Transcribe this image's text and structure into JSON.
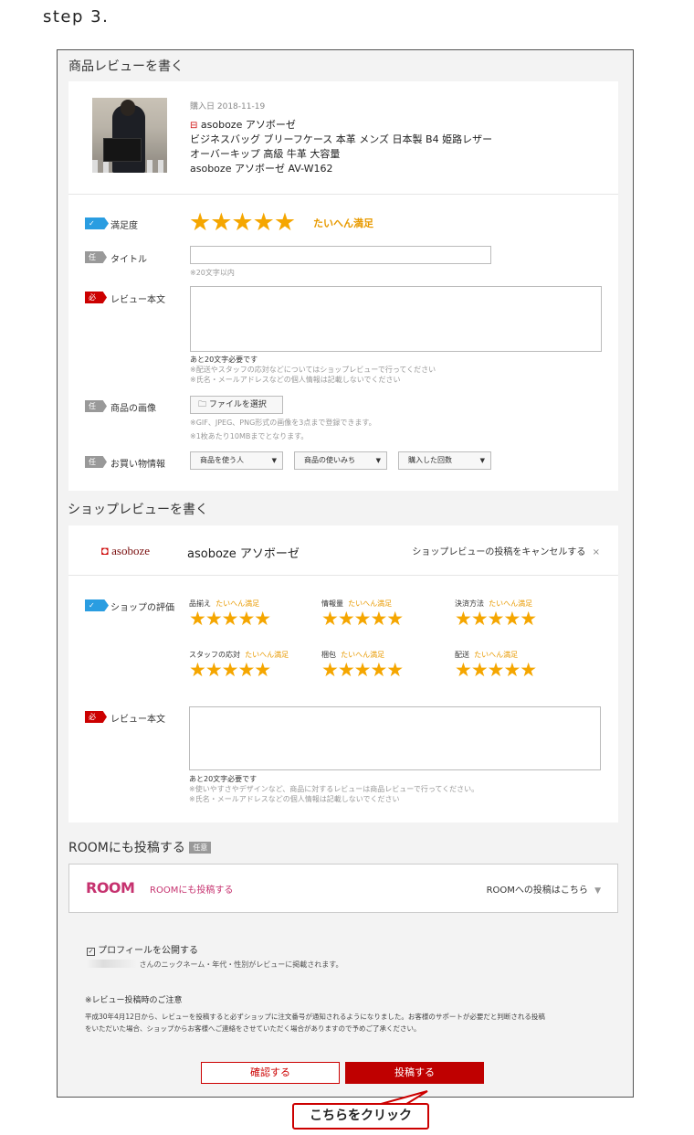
{
  "step_title": "step 3.",
  "product_review": {
    "heading": "商品レビューを書く",
    "purchase_date": "購入日 2018-11-19",
    "shop_name": "asoboze アソボーゼ",
    "product_name_1": "ビジネスバッグ ブリーフケース 本革 メンズ 日本製 B4 姫路レザー",
    "product_name_2": "オーバーキップ 高級 牛革 大容量",
    "product_name_3": "asoboze アソボーゼ AV-W162",
    "satisfaction_tag": "",
    "satisfaction_label": "満足度",
    "satisfaction_stars": "★★★★★",
    "satisfaction_rating": 5,
    "satisfaction_text": "たいへん満足",
    "title_tag": "任意",
    "title_label": "タイトル",
    "title_value": "",
    "title_hint": "※20文字以内",
    "body_tag": "必須",
    "body_label": "レビュー本文",
    "body_value": "",
    "body_remaining": "あと20文字必要です",
    "body_hint_1": "※配送やスタッフの応対などについてはショップレビューで行ってください",
    "body_hint_2": "※氏名・メールアドレスなどの個人情報は記載しないでください",
    "image_tag": "任意",
    "image_label": "商品の画像",
    "file_button": "ファイルを選択",
    "image_hint_1": "※GIF、JPEG、PNG形式の画像を3点まで登録できます。",
    "image_hint_2": "※1枚あたり10MBまでとなります。",
    "shopping_tag": "任意",
    "shopping_label": "お買い物情報",
    "select_1": "商品を使う人",
    "select_2": "商品の使いみち",
    "select_3": "購入した回数"
  },
  "shop_review": {
    "heading": "ショップレビューを書く",
    "logo_text": "asoboze",
    "shop_name": "asoboze アソボーゼ",
    "cancel_text": "ショップレビューの投稿をキャンセルする",
    "cancel_icon": "×",
    "eval_label": "ショップの評価",
    "ratings": [
      {
        "label": "品揃え",
        "value": "たいへん満足",
        "stars": "★★★★★",
        "score": 5
      },
      {
        "label": "情報量",
        "value": "たいへん満足",
        "stars": "★★★★★",
        "score": 5
      },
      {
        "label": "決済方法",
        "value": "たいへん満足",
        "stars": "★★★★★",
        "score": 5
      },
      {
        "label": "スタッフの応対",
        "value": "たいへん満足",
        "stars": "★★★★★",
        "score": 5
      },
      {
        "label": "梱包",
        "value": "たいへん満足",
        "stars": "★★★★★",
        "score": 5
      },
      {
        "label": "配送",
        "value": "たいへん満足",
        "stars": "★★★★★",
        "score": 5
      }
    ],
    "body_tag": "必須",
    "body_label": "レビュー本文",
    "body_value": "",
    "body_remaining": "あと20文字必要です",
    "body_hint_1": "※使いやすさやデザインなど、商品に対するレビューは商品レビューで行ってください。",
    "body_hint_2": "※氏名・メールアドレスなどの個人情報は記載しないでください"
  },
  "room": {
    "heading": "ROOMにも投稿する",
    "heading_tag": "任意",
    "logo": "ROOM",
    "link_text": "ROOMにも投稿する",
    "toggle_text": "ROOMへの投稿はこちら",
    "toggle_icon": "▼"
  },
  "profile": {
    "checkbox_label": "プロフィールを公開する",
    "checked": true,
    "note": "さんのニックネーム・年代・性別がレビューに掲載されます。"
  },
  "notice": {
    "heading": "※レビュー投稿時のご注意",
    "line_1": "平成30年4月12日から、レビューを投稿すると必ずショップに注文番号が通知されるようになりました。お客様のサポートが必要だと判断される投稿",
    "line_2": "をいただいた場合、ショップからお客様へご連絡をさせていただく場合がありますので予めご了承ください。"
  },
  "buttons": {
    "confirm": "確認する",
    "post": "投稿する"
  },
  "callout": "こちらをクリック",
  "colors": {
    "star": "#f5a600",
    "primary_red": "#bf0000",
    "room_pink": "#c6326f",
    "check_blue": "#2a9de1"
  }
}
